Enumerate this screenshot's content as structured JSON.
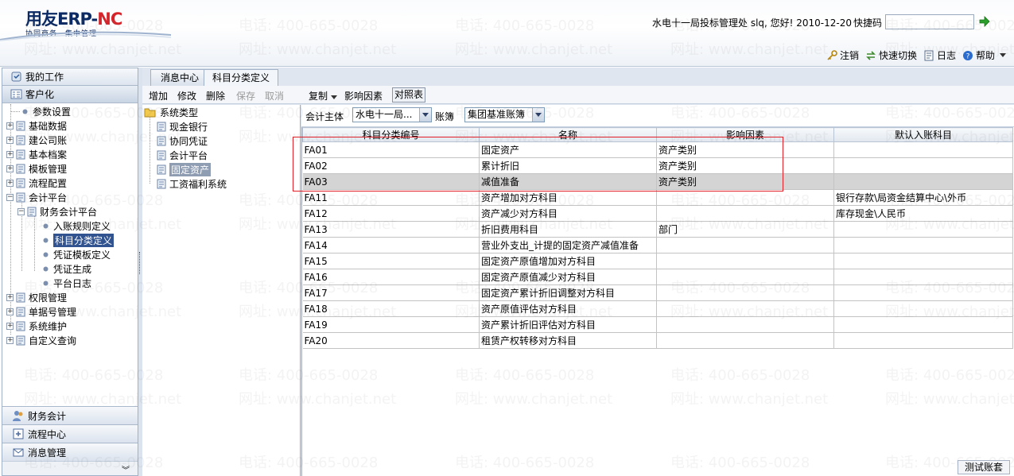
{
  "header": {
    "logo_brand_a": "用友",
    "logo_brand_b": "ERP-",
    "logo_brand_c": "NC",
    "logo_slogan": "协同商务　集中管理",
    "user_info": "水电十一局投标管理处 slq, 您好! 2010-12-20",
    "shortcut_label": "快捷码",
    "shortcut_value": "",
    "actions": {
      "logout": "注销",
      "quick_switch": "快速切换",
      "log": "日志",
      "help": "帮助"
    }
  },
  "sidebar": {
    "my_work": "我的工作",
    "customize": "客户化",
    "tree": {
      "params": "参数设置",
      "basic_data": "基础数据",
      "build_account": "建公司账",
      "basic_archive": "基本档案",
      "template_mgmt": "模板管理",
      "flow_config": "流程配置",
      "acct_platform": "会计平台",
      "fin_acct_platform": "财务会计平台",
      "entry_rule": "入账规则定义",
      "subject_class": "科目分类定义",
      "voucher_template": "凭证模板定义",
      "voucher_gen": "凭证生成",
      "platform_log": "平台日志",
      "perm_mgmt": "权限管理",
      "doc_no_mgmt": "单据号管理",
      "sys_maint": "系统维护",
      "custom_query": "自定义查询"
    },
    "footer": {
      "finance": "财务会计",
      "flow_center": "流程中心",
      "msg_mgmt": "消息管理",
      "more": "»"
    }
  },
  "tabs": {
    "msg_center": "消息中心",
    "subject_class": "科目分类定义"
  },
  "toolbar": {
    "add": "增加",
    "edit": "修改",
    "delete": "删除",
    "save": "保存",
    "cancel": "取消",
    "copy": "复制",
    "factors": "影响因素",
    "compare": "对照表"
  },
  "type_tree": {
    "root": "系统类型",
    "items": [
      "现金银行",
      "协同凭证",
      "会计平台",
      "固定资产",
      "工资福利系统"
    ]
  },
  "filter": {
    "entity_label": "会计主体",
    "entity_value": "水电十一局...",
    "book_label": "账簿",
    "book_value": "集团基准账簿"
  },
  "grid": {
    "columns": [
      "科目分类编号",
      "名称",
      "影响因素",
      "默认入账科目"
    ],
    "rows": [
      [
        "FA01",
        "固定资产",
        "资产类别",
        ""
      ],
      [
        "FA02",
        "累计折旧",
        "资产类别",
        ""
      ],
      [
        "FA03",
        "减值准备",
        "资产类别",
        ""
      ],
      [
        "FA11",
        "资产增加对方科目",
        "",
        "银行存款\\局资金结算中心\\外币"
      ],
      [
        "FA12",
        "资产减少对方科目",
        "",
        "库存现金\\人民币"
      ],
      [
        "FA13",
        "折旧费用科目",
        "部门",
        ""
      ],
      [
        "FA14",
        "营业外支出_计提的固定资产减值准备",
        "",
        ""
      ],
      [
        "FA15",
        "固定资产原值增加对方科目",
        "",
        ""
      ],
      [
        "FA16",
        "固定资产原值减少对方科目",
        "",
        ""
      ],
      [
        "FA17",
        "固定资产累计折旧调整对方科目",
        "",
        ""
      ],
      [
        "FA18",
        "资产原值评估对方科目",
        "",
        ""
      ],
      [
        "FA19",
        "资产累计折旧评估对方科目",
        "",
        ""
      ],
      [
        "FA20",
        "租赁产权转移对方科目",
        "",
        ""
      ]
    ],
    "selected_row": 2
  },
  "watermark": {
    "phone": "电话: 400-665-0028",
    "site": "网址: www.chanjet.net"
  },
  "status": {
    "test_account": "测试账套"
  },
  "colors": {
    "highlight_box": "#e21f26",
    "selected_nav": "#31538f",
    "brand_red": "#d6242a",
    "brand_blue": "#0b2a63"
  }
}
